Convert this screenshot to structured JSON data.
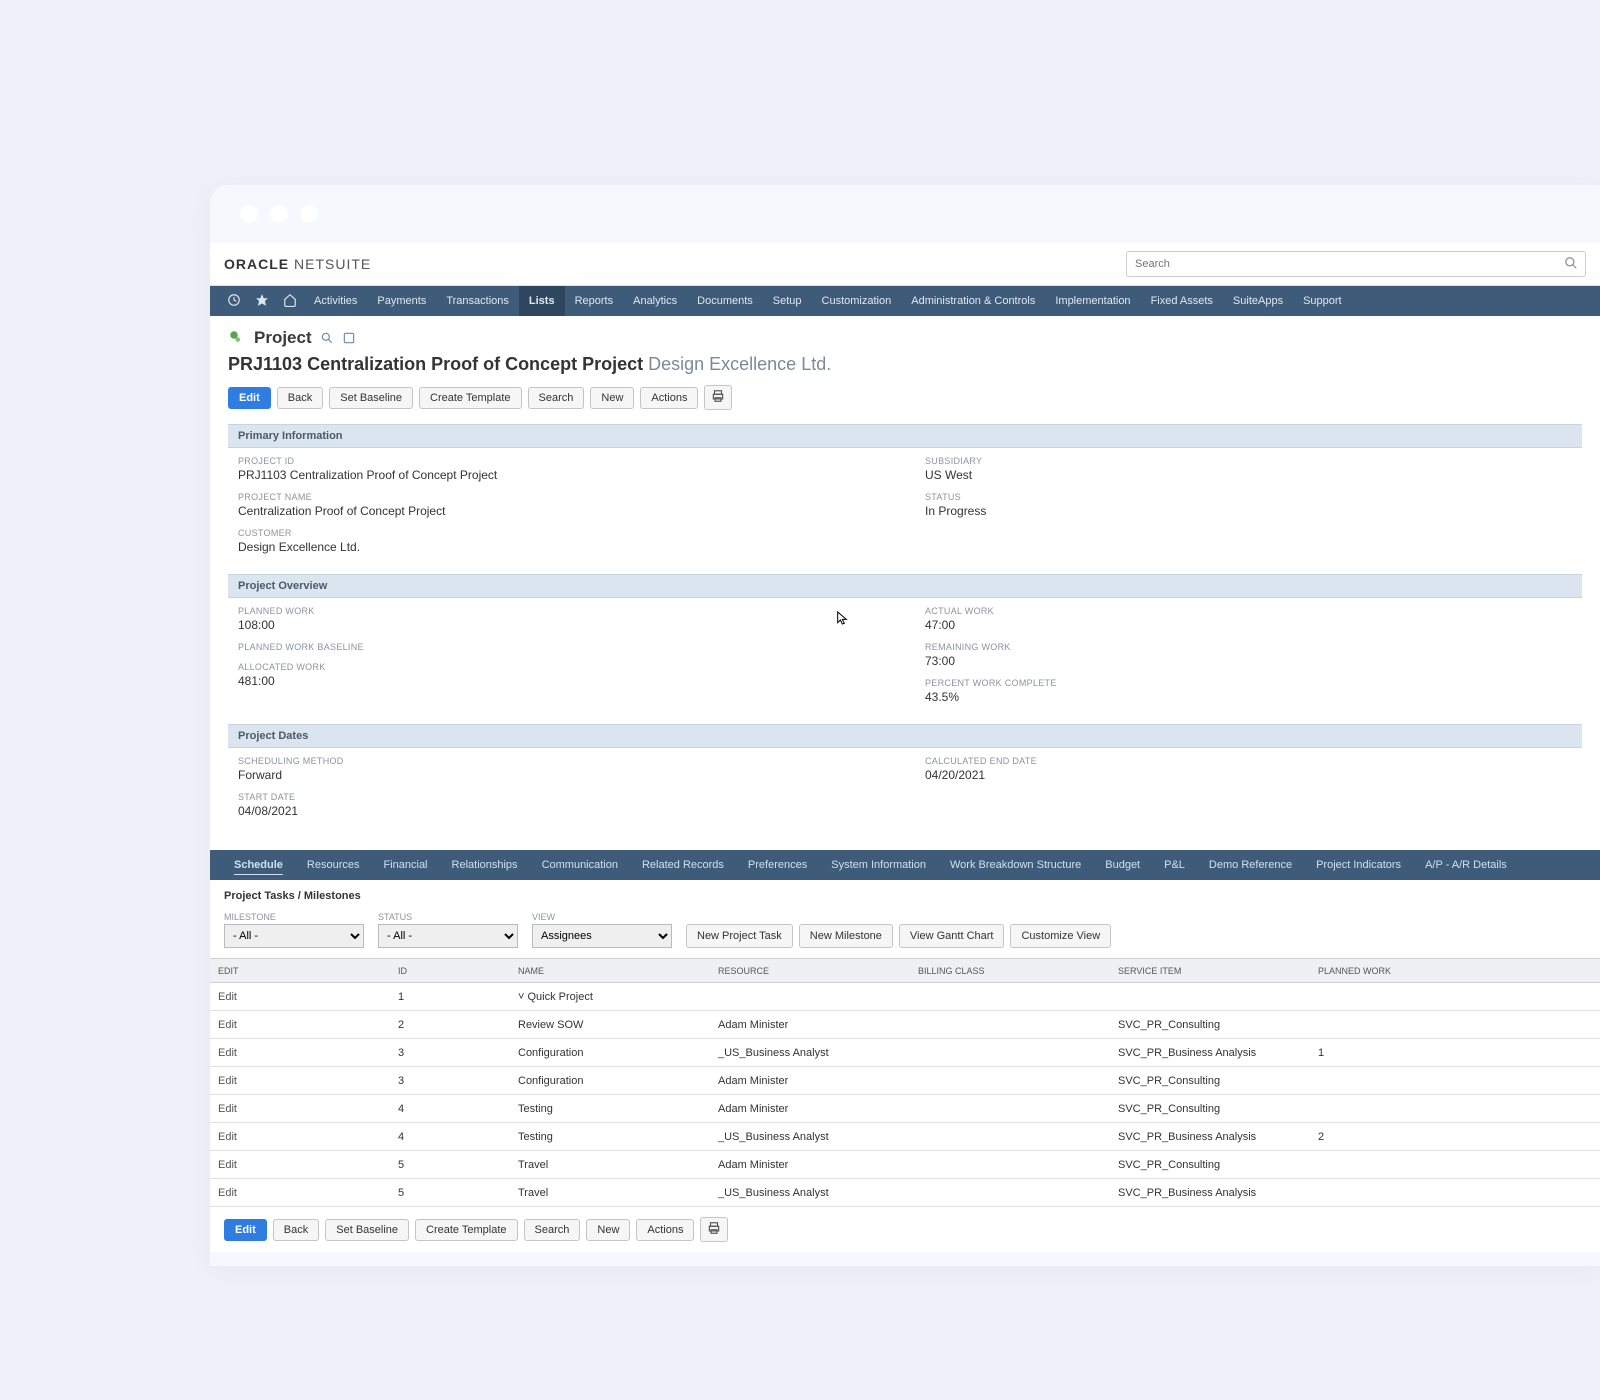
{
  "brand": {
    "oracle": "ORACLE",
    "netsuite": "NETSUITE"
  },
  "search": {
    "placeholder": "Search"
  },
  "menubar": [
    "Activities",
    "Payments",
    "Transactions",
    "Lists",
    "Reports",
    "Analytics",
    "Documents",
    "Setup",
    "Customization",
    "Administration & Controls",
    "Implementation",
    "Fixed Assets",
    "SuiteApps",
    "Support"
  ],
  "active_menu_index": 3,
  "page_type": "Project",
  "title": {
    "bold": "PRJ1103 Centralization Proof of Concept Project",
    "customer": "Design Excellence Ltd."
  },
  "action_buttons_top": [
    "Edit",
    "Back",
    "Set Baseline",
    "Create Template",
    "Search",
    "New",
    "Actions"
  ],
  "sections": {
    "primary": {
      "header": "Primary Information",
      "left": [
        {
          "label": "PROJECT ID",
          "value": "PRJ1103 Centralization Proof of Concept Project"
        },
        {
          "label": "PROJECT NAME",
          "value": "Centralization Proof of Concept Project"
        },
        {
          "label": "CUSTOMER",
          "value": "Design Excellence Ltd."
        }
      ],
      "right": [
        {
          "label": "SUBSIDIARY",
          "value": "US West"
        },
        {
          "label": "STATUS",
          "value": "In Progress"
        }
      ]
    },
    "overview": {
      "header": "Project Overview",
      "left": [
        {
          "label": "PLANNED WORK",
          "value": "108:00"
        },
        {
          "label": "PLANNED WORK BASELINE",
          "value": ""
        },
        {
          "label": "ALLOCATED WORK",
          "value": "481:00"
        }
      ],
      "right": [
        {
          "label": "ACTUAL WORK",
          "value": "47:00"
        },
        {
          "label": "REMAINING WORK",
          "value": "73:00"
        },
        {
          "label": "PERCENT WORK COMPLETE",
          "value": "43.5%"
        }
      ]
    },
    "dates": {
      "header": "Project Dates",
      "left": [
        {
          "label": "SCHEDULING METHOD",
          "value": "Forward"
        },
        {
          "label": "START DATE",
          "value": "04/08/2021"
        }
      ],
      "right": [
        {
          "label": "CALCULATED END DATE",
          "value": "04/20/2021"
        }
      ]
    }
  },
  "record_tabs": [
    "Schedule",
    "Resources",
    "Financial",
    "Relationships",
    "Communication",
    "Related Records",
    "Preferences",
    "System Information",
    "Work Breakdown Structure",
    "Budget",
    "P&L",
    "Demo Reference",
    "Project Indicators",
    "A/P - A/R Details"
  ],
  "active_record_tab_index": 0,
  "sub_header": "Project Tasks / Milestones",
  "filters": {
    "milestone": {
      "label": "MILESTONE",
      "value": "- All -"
    },
    "status": {
      "label": "STATUS",
      "value": "- All -"
    },
    "view": {
      "label": "VIEW",
      "value": "Assignees"
    }
  },
  "filter_buttons": [
    "New Project Task",
    "New Milestone",
    "View Gantt Chart",
    "Customize View"
  ],
  "grid": {
    "columns": [
      "EDIT",
      "ID",
      "",
      "NAME",
      "RESOURCE",
      "BILLING CLASS",
      "SERVICE ITEM",
      "PLANNED WORK"
    ],
    "edit_label": "Edit",
    "rows": [
      {
        "id": "1",
        "name": "Quick Project",
        "resource": "",
        "billing": "",
        "service": "",
        "planned": ""
      },
      {
        "id": "2",
        "name": "Review SOW",
        "resource": "Adam Minister",
        "billing": "",
        "service": "SVC_PR_Consulting",
        "planned": ""
      },
      {
        "id": "3",
        "name": "Configuration",
        "resource": "_US_Business Analyst",
        "billing": "",
        "service": "SVC_PR_Business Analysis",
        "planned": "1"
      },
      {
        "id": "3",
        "name": "Configuration",
        "resource": "Adam Minister",
        "billing": "",
        "service": "SVC_PR_Consulting",
        "planned": ""
      },
      {
        "id": "4",
        "name": "Testing",
        "resource": "Adam Minister",
        "billing": "",
        "service": "SVC_PR_Consulting",
        "planned": ""
      },
      {
        "id": "4",
        "name": "Testing",
        "resource": "_US_Business Analyst",
        "billing": "",
        "service": "SVC_PR_Business Analysis",
        "planned": "2"
      },
      {
        "id": "5",
        "name": "Travel",
        "resource": "Adam Minister",
        "billing": "",
        "service": "SVC_PR_Consulting",
        "planned": ""
      },
      {
        "id": "5",
        "name": "Travel",
        "resource": "_US_Business Analyst",
        "billing": "",
        "service": "SVC_PR_Business Analysis",
        "planned": ""
      }
    ]
  },
  "action_buttons_bottom": [
    "Edit",
    "Back",
    "Set Baseline",
    "Create Template",
    "Search",
    "New",
    "Actions"
  ]
}
